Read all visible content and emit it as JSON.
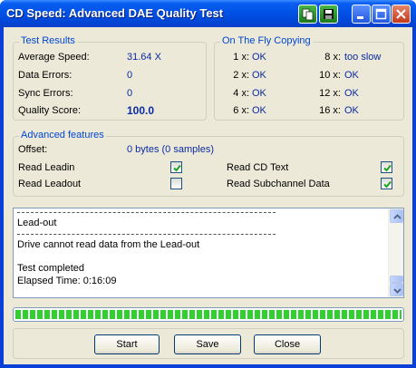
{
  "window": {
    "title": "CD Speed: Advanced DAE Quality Test",
    "colors": {
      "title_bar": "#0052e6",
      "group_title": "#0046d5",
      "value_text": "#0b2aa3",
      "progress_fill": "#2fd02f",
      "close_button": "#c4391c"
    },
    "title_buttons": [
      "copy-icon",
      "save-icon",
      "minimize-icon",
      "maximize-icon",
      "close-icon"
    ]
  },
  "test_results": {
    "title": "Test Results",
    "rows": [
      {
        "label": "Average Speed:",
        "value": "31.64 X"
      },
      {
        "label": "Data Errors:",
        "value": "0"
      },
      {
        "label": "Sync Errors:",
        "value": "0"
      },
      {
        "label": "Quality Score:",
        "value": "100.0"
      }
    ]
  },
  "on_the_fly": {
    "title": "On The Fly Copying",
    "left": [
      {
        "speed": "1 x:",
        "status": "OK"
      },
      {
        "speed": "2 x:",
        "status": "OK"
      },
      {
        "speed": "4 x:",
        "status": "OK"
      },
      {
        "speed": "6 x:",
        "status": "OK"
      }
    ],
    "right": [
      {
        "speed": "8 x:",
        "status": "too slow"
      },
      {
        "speed": "10 x:",
        "status": "OK"
      },
      {
        "speed": "12 x:",
        "status": "OK"
      },
      {
        "speed": "16 x:",
        "status": "OK"
      }
    ]
  },
  "advanced": {
    "title": "Advanced features",
    "offset_label": "Offset:",
    "offset_value": "0 bytes (0 samples)",
    "read_leadin": {
      "label": "Read Leadin",
      "checked": true
    },
    "read_leadout": {
      "label": "Read Leadout",
      "checked": false
    },
    "read_cd_text": {
      "label": "Read CD Text",
      "checked": true
    },
    "read_subchannel": {
      "label": "Read Subchannel Data",
      "checked": true
    }
  },
  "log": {
    "lines": [
      "Lead-out",
      "Drive cannot read data from the Lead-out",
      "Test completed",
      "Elapsed Time:  0:16:09"
    ]
  },
  "progress": {
    "percent": 100
  },
  "buttons": {
    "start": "Start",
    "save": "Save",
    "close": "Close"
  }
}
